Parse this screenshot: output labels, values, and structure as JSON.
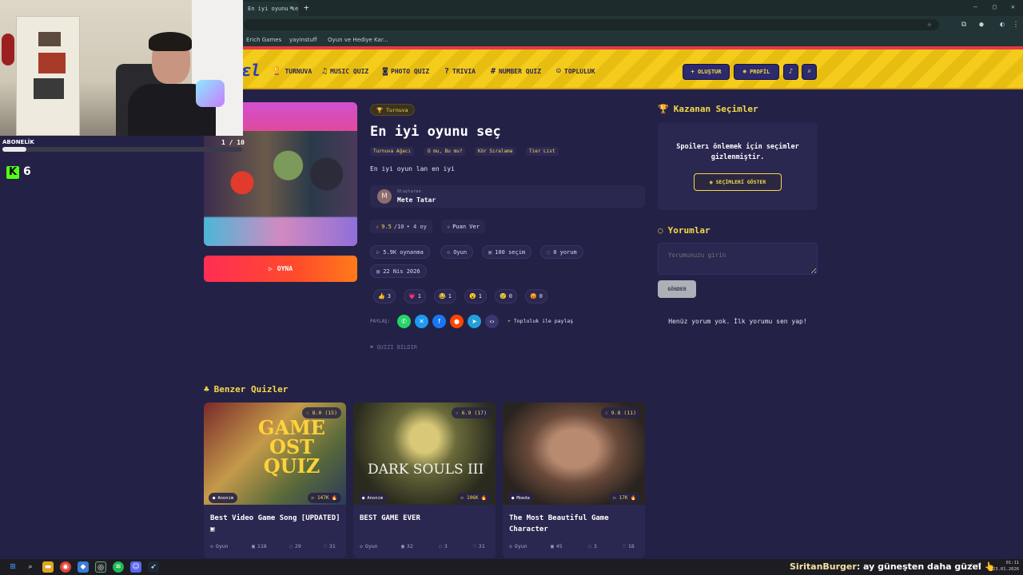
{
  "browser": {
    "tab_title": "En iyi oyunu seç - Tier List | Kız",
    "bookmarks": [
      "Erich Games",
      "yayinstuff",
      "Oyun ve Hediye Kar..."
    ]
  },
  "overlay": {
    "subscription_label": "ABONELİK",
    "subscription_progress": 0.1,
    "kick_count": "6"
  },
  "header": {
    "nav": [
      {
        "label": "TURNUVA",
        "icon": "trophy-icon"
      },
      {
        "label": "MUSIC QUIZ",
        "icon": "music-icon"
      },
      {
        "label": "PHOTO QUIZ",
        "icon": "camera-icon"
      },
      {
        "label": "TRIVIA",
        "icon": "question-icon"
      },
      {
        "label": "NUMBER QUIZ",
        "icon": "hash-icon"
      },
      {
        "label": "TOPLULUK",
        "icon": "people-icon"
      }
    ],
    "create_label": "+ OLUŞTUR",
    "profile_label": "PROFİL"
  },
  "quiz": {
    "counter": "1 / 10",
    "play_label": "OYNA",
    "category": "Turnuva",
    "title": "En iyi oyunu seç",
    "tags": [
      "Turnuva Ağacı",
      "O mu, Bu mu?",
      "Kör Sıralama",
      "Tier List"
    ],
    "description": "En iyi oyun lan en iyi",
    "creator_label": "Oluşturan",
    "creator_name": "Mete Tatar",
    "creator_initial": "M",
    "rating_value": "9.5",
    "rating_max": "/10",
    "rating_count": "• 4 oy",
    "rate_label": "Puan Ver",
    "stats": {
      "plays": "5.9K oynanma",
      "type": "Oyun",
      "choices": "100 seçim",
      "comments": "0 yorum",
      "date": "22 Nis 2026"
    },
    "reactions": [
      {
        "emoji": "👍",
        "count": "3"
      },
      {
        "emoji": "💗",
        "count": "1"
      },
      {
        "emoji": "😂",
        "count": "1"
      },
      {
        "emoji": "😮",
        "count": "1"
      },
      {
        "emoji": "😢",
        "count": "0"
      },
      {
        "emoji": "😡",
        "count": "0"
      }
    ],
    "share_label": "PAYLAŞ:",
    "community_share_label": "Topluluk ile paylaş",
    "report_label": "QUİZİ BİLDİR"
  },
  "sidebar": {
    "winners_heading": "Kazanan Seçimler",
    "spoiler_text": "Spoilerı önlemek için seçimler gizlenmiştir.",
    "show_button": "SEÇİMLERİ GÖSTER",
    "comments_heading": "Yorumlar",
    "comment_placeholder": "Yorumunuzu girin",
    "send_button": "GÖNDER",
    "no_comments": "Henüz yorum yok. İlk yorumu sen yap!"
  },
  "similar": {
    "heading": "Benzer Quizler",
    "cards": [
      {
        "title": "Best Video Game Song [UPDATED]",
        "rating": "☆ 8.0 (15)",
        "author": "Anonim",
        "plays": "▷ 147K",
        "type": "Oyun",
        "choices": "118",
        "comments": "29",
        "likes": "31",
        "img_text": "GAME OST QUIZ"
      },
      {
        "title": "BEST GAME EVER",
        "rating": "☆ 6.9 (17)",
        "author": "Anonim",
        "plays": "▷ 106K",
        "type": "Oyun",
        "choices": "32",
        "comments": "3",
        "likes": "31",
        "img_text": "DARK SOULS III"
      },
      {
        "title": "The Most Beautiful Game Character",
        "rating": "☆ 9.8 (11)",
        "author": "Moeda",
        "plays": "▷ 17K",
        "type": "Oyun",
        "choices": "45",
        "comments": "3",
        "likes": "18",
        "img_text": ""
      }
    ]
  },
  "taskbar": {
    "chat_user": "SiritanBurger",
    "chat_message": ": ay güneşten daha güzel",
    "time": "01:11",
    "date": "23.01.2026"
  },
  "colors": {
    "accent_yellow": "#f5d94a",
    "background": "#242146",
    "play_red": "#ff2d55"
  }
}
